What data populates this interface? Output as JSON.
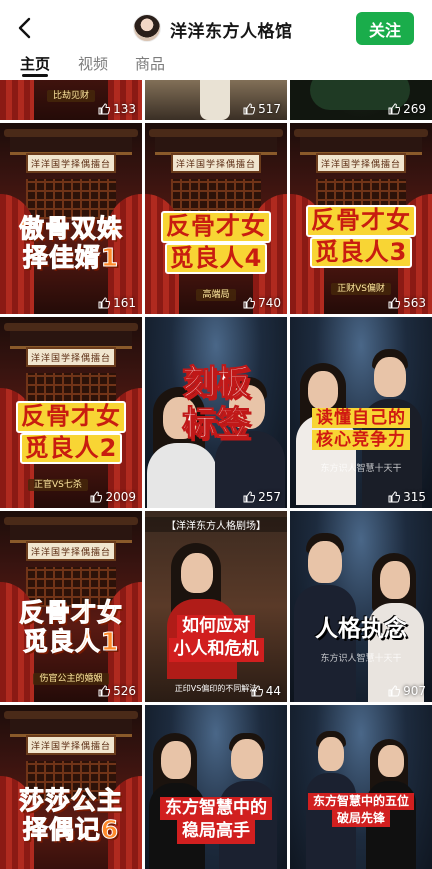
{
  "header": {
    "channel_name": "洋洋东方人格馆",
    "follow_label": "关注"
  },
  "tabs": [
    {
      "label": "主页",
      "active": true
    },
    {
      "label": "视频",
      "active": false
    },
    {
      "label": "商品",
      "active": false
    }
  ],
  "videos": [
    {
      "title_line1": "",
      "title_line2": "",
      "tag": "",
      "likes": "133",
      "style": "stage-partial"
    },
    {
      "title_line1": "",
      "title_line2": "",
      "tag": "",
      "likes": "517",
      "style": "scene-partial"
    },
    {
      "title_line1": "",
      "title_line2": "",
      "tag": "",
      "likes": "269",
      "style": "green-partial"
    },
    {
      "sign": "洋洋国学择偶擂台",
      "title_line1": "傲骨双姝",
      "title_line2": "择佳婿1",
      "tag": "",
      "likes": "161",
      "style": "stage-orange"
    },
    {
      "sign": "洋洋国学择偶擂台",
      "title_line1": "反骨才女",
      "title_line2": "觅良人4",
      "tag": "高端局",
      "likes": "740",
      "style": "stage-yellow"
    },
    {
      "sign": "洋洋国学择偶擂台",
      "title_line1": "反骨才女",
      "title_line2": "觅良人3",
      "tag": "正财VS偏财",
      "likes": "563",
      "style": "stage-yellow"
    },
    {
      "sign": "洋洋国学择偶擂台",
      "title_line1": "反骨才女",
      "title_line2": "觅良人2",
      "tag": "正官VS七杀",
      "likes": "2009",
      "style": "stage-yellow"
    },
    {
      "title_line1": "刻板",
      "title_line2": "标签",
      "tag": "",
      "likes": "257",
      "style": "studio-big"
    },
    {
      "title_line1": "读懂自己的",
      "title_line2": "核心竞争力",
      "tag": "东方识人智慧十天干",
      "likes": "315",
      "style": "studio-yellow"
    },
    {
      "sign": "洋洋国学择偶擂台",
      "title_line1": "反骨才女",
      "title_line2": "觅良人1",
      "tag": "伤官公主的婚姻",
      "likes": "526",
      "style": "stage-orange"
    },
    {
      "sign": "【洋洋东方人格剧场】",
      "title_line1": "如何应对",
      "title_line2": "小人和危机",
      "tag": "正印VS偏印的不同解法",
      "likes": "44",
      "style": "drama"
    },
    {
      "title_line1": "人格执念",
      "title_line2": "",
      "tag": "东方识人智慧十天干",
      "likes": "907",
      "style": "studio-white"
    },
    {
      "sign": "洋洋国学择偶擂台",
      "title_line1": "莎莎公主",
      "title_line2": "择偶记6",
      "tag": "",
      "likes": "",
      "style": "stage-orange"
    },
    {
      "title_line1": "东方智慧中的",
      "title_line2": "稳局高手",
      "tag": "",
      "likes": "",
      "style": "studio-red"
    },
    {
      "title_line1": "东方智慧中的五位",
      "title_line2": "破局先锋",
      "tag": "",
      "likes": "",
      "style": "studio-red-small"
    }
  ]
}
